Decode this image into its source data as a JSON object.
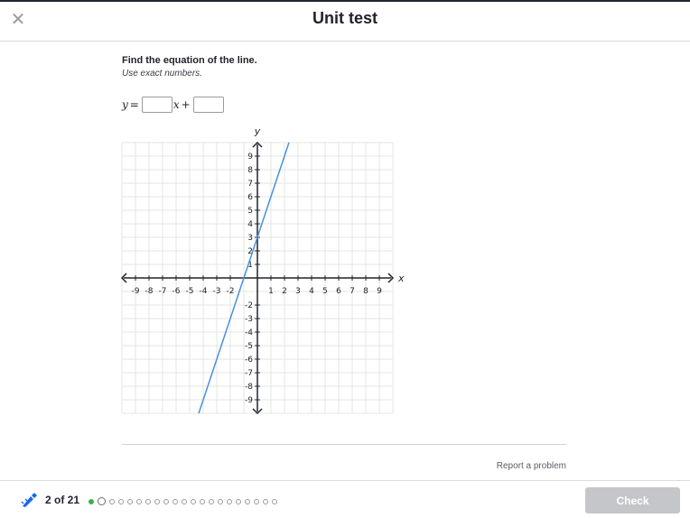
{
  "header": {
    "title": "Unit test",
    "close_icon": "close-icon"
  },
  "question": {
    "prompt": "Find the equation of the line.",
    "hint": "Use exact numbers.",
    "equation": {
      "lhs": "y",
      "equals": "=",
      "x_var": "x",
      "plus": "+"
    },
    "answer_boxes": [
      "",
      ""
    ]
  },
  "chart_data": {
    "type": "line",
    "xlabel": "x",
    "ylabel": "y",
    "xlim": [
      -10,
      10
    ],
    "ylim": [
      -10,
      10
    ],
    "grid": true,
    "x_ticks": [
      -9,
      -8,
      -7,
      -6,
      -5,
      -4,
      -3,
      -2,
      1,
      2,
      3,
      4,
      5,
      6,
      7,
      8,
      9
    ],
    "y_ticks": [
      9,
      8,
      7,
      6,
      5,
      4,
      3,
      2,
      1,
      -2,
      -3,
      -4,
      -5,
      -6,
      -7,
      -8,
      -9
    ],
    "series": [
      {
        "x": [
          -4.33,
          2.33
        ],
        "y": [
          -10,
          10
        ],
        "color": "#4a90d9"
      }
    ]
  },
  "footer": {
    "report_label": "Report a problem",
    "progress_label": "2 of 21",
    "total_questions": 21,
    "completed": 1,
    "current": 2,
    "check_label": "Check",
    "done_color": "#37b24d"
  }
}
